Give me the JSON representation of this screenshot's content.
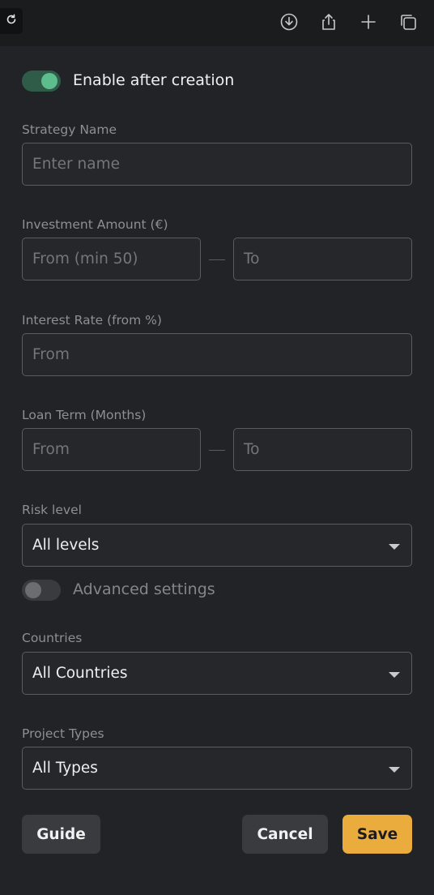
{
  "topbar": {
    "icons": [
      "reload-icon",
      "download-icon",
      "share-icon",
      "plus-icon",
      "copy-icon"
    ]
  },
  "form": {
    "enable_toggle": {
      "label": "Enable after creation",
      "on": true
    },
    "strategy_name": {
      "label": "Strategy Name",
      "placeholder": "Enter name"
    },
    "investment_amount": {
      "label": "Investment Amount (€)",
      "from_placeholder": "From (min 50)",
      "to_placeholder": "To"
    },
    "interest_rate": {
      "label": "Interest Rate (from %)",
      "placeholder": "From"
    },
    "loan_term": {
      "label": "Loan Term (Months)",
      "from_placeholder": "From",
      "to_placeholder": "To"
    },
    "risk_level": {
      "label": "Risk level",
      "value": "All levels"
    },
    "advanced_toggle": {
      "label": "Advanced settings",
      "on": false
    },
    "countries": {
      "label": "Countries",
      "value": "All Countries"
    },
    "project_types": {
      "label": "Project Types",
      "value": "All Types"
    }
  },
  "actions": {
    "guide_label": "Guide",
    "cancel_label": "Cancel",
    "save_label": "Save"
  },
  "colors": {
    "background": "#222326",
    "accent": "#ebac3e",
    "toggle_on": "#5dbd8c"
  }
}
